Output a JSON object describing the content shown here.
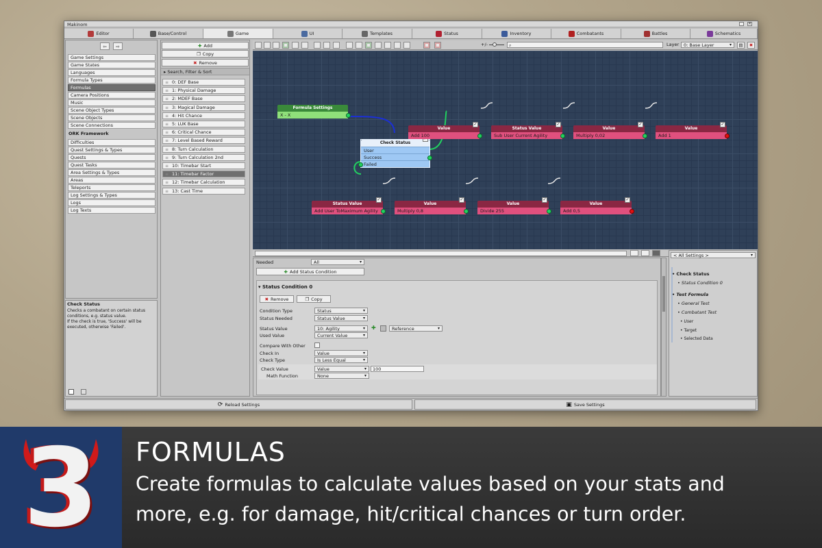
{
  "window": {
    "title": "Makinom"
  },
  "tabs": [
    {
      "label": "Editor",
      "icon": "wrench-icon"
    },
    {
      "label": "Base/Control",
      "icon": "gamepad-icon"
    },
    {
      "label": "Game",
      "icon": "cube-icon"
    },
    {
      "label": "UI",
      "icon": "ui-icon"
    },
    {
      "label": "Templates",
      "icon": "template-icon"
    },
    {
      "label": "Status",
      "icon": "heart-icon"
    },
    {
      "label": "Inventory",
      "icon": "potion-icon"
    },
    {
      "label": "Combatants",
      "icon": "combatant-icon"
    },
    {
      "label": "Battles",
      "icon": "swords-icon"
    },
    {
      "label": "Schematics",
      "icon": "schematic-icon"
    }
  ],
  "active_tab": "Game",
  "sidebar": {
    "game_items": [
      "Game Settings",
      "Game States",
      "Languages",
      "Formula Types",
      "Formulas",
      "Camera Positions",
      "Music",
      "Scene Object Types",
      "Scene Objects",
      "Scene Connections"
    ],
    "ork_header": "ORK Framework",
    "ork_items": [
      "Difficulties",
      "Quest Settings & Types",
      "Quests",
      "Quest Tasks",
      "Area Settings & Types",
      "Areas",
      "Teleports",
      "Log Settings & Types",
      "Logs",
      "Log Texts"
    ],
    "selected": "Formulas",
    "help_title": "Check Status",
    "help_text": "Checks a combatant on certain status conditions, e.g. status value.\nIf the check is true, 'Success' will be executed, otherwise 'Failed'."
  },
  "formula_list": {
    "add_label": "Add",
    "copy_label": "Copy",
    "remove_label": "Remove",
    "search_label": "Search, Filter & Sort",
    "items": [
      "0: DEF Base",
      "1: Physical Damage",
      "2: MDEF Base",
      "3: Magical Damage",
      "4: Hit Chance",
      "5: LUK Base",
      "6: Critical Chance",
      "7: Level Based Reward",
      "8: Turn Calculation",
      "9: Turn Calculation 2nd",
      "10: Timebar Start",
      "11: Timebar Factor",
      "12: Timebar Calculation",
      "13: Cast Time"
    ],
    "selected": "11: Timebar Factor"
  },
  "toolbar": {
    "zoom_label": "+/-",
    "layer_label": "Layer",
    "layer_value": "0: Base Layer"
  },
  "graph": {
    "formula_settings": {
      "title": "Formula Settings",
      "row": "X - X"
    },
    "check_status": {
      "title": "Check Status",
      "rows": [
        "User",
        "Success",
        "Failed"
      ]
    },
    "row1": [
      {
        "title": "Value",
        "row": "Add 100"
      },
      {
        "title": "Status Value",
        "row": "Sub User Current Agility"
      },
      {
        "title": "Value",
        "row": "Multiply 0,02"
      },
      {
        "title": "Value",
        "row": "Add 1"
      }
    ],
    "row2": [
      {
        "title": "Status Value",
        "row": "Add User ToMaximum Agility"
      },
      {
        "title": "Value",
        "row": "Multiply 0,8"
      },
      {
        "title": "Value",
        "row": "Divide 255"
      },
      {
        "title": "Value",
        "row": "Add 0,5"
      }
    ]
  },
  "inspector": {
    "needed_label": "Needed",
    "needed_value": "All",
    "add_condition": "Add Status Condition",
    "section_title": "Status Condition 0",
    "remove_label": "Remove",
    "copy_label": "Copy",
    "fields": {
      "condition_type": {
        "label": "Condition Type",
        "value": "Status"
      },
      "status_needed": {
        "label": "Status Needed",
        "value": "Status Value"
      },
      "status_value": {
        "label": "Status Value",
        "value": "10: Agility",
        "extra": "Reference"
      },
      "used_value": {
        "label": "Used Value",
        "value": "Current Value"
      },
      "compare_with_other": {
        "label": "Compare With Other"
      },
      "check_in": {
        "label": "Check In",
        "value": "Value"
      },
      "check_type": {
        "label": "Check Type",
        "value": "Is Less Equal"
      },
      "check_value": {
        "label": "Check Value",
        "value": "Value",
        "number": "100"
      },
      "math_function": {
        "label": "Math Function",
        "value": "None"
      }
    }
  },
  "settings_tree": {
    "dropdown": "< All Settings >",
    "items": [
      {
        "label": "Check Status",
        "level": 0,
        "style": "bold"
      },
      {
        "label": "Status Condition 0",
        "level": 1,
        "style": "italic"
      },
      {
        "label": "Test Formula",
        "level": 0,
        "style": "bolditalic"
      },
      {
        "label": "General Test",
        "level": 1,
        "style": "italic"
      },
      {
        "label": "Combatant Test",
        "level": 1,
        "style": "italic"
      },
      {
        "label": "User",
        "level": 2,
        "style": "italic"
      },
      {
        "label": "Target",
        "level": 2,
        "style": "normal"
      },
      {
        "label": "Selected Data",
        "level": 2,
        "style": "normal"
      }
    ]
  },
  "footer": {
    "reload_label": "Reload Settings",
    "save_label": "Save Settings"
  },
  "banner": {
    "number": "3",
    "title": "FORMULAS",
    "line1": "Create formulas to calculate values based on your stats and",
    "line2": "more, e.g. for damage, hit/critical chances or turn order."
  },
  "colors": {
    "value_node": "#e0507e",
    "value_header": "#8a2743",
    "status_node": "#e0507e",
    "formula_node": "#8fe07a",
    "check_node": "#9ec8f4",
    "banner_accent": "#d01a1a"
  }
}
